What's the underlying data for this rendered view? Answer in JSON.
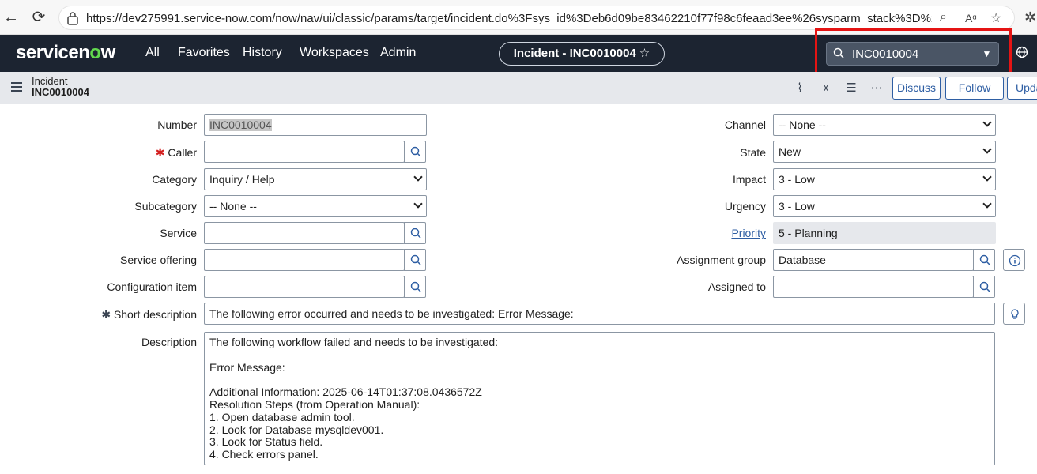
{
  "browser": {
    "url": "https://dev275991.service-now.com/now/nav/ui/classic/params/target/incident.do%3Fsys_id%3Deb6d09be83462210f77f98c6feaad3ee%26sysparm_stack%3D%26sysparm_..."
  },
  "header": {
    "logo_text": "servicen",
    "logo_o": "o",
    "logo_w": "w",
    "nav": [
      "All",
      "Favorites",
      "History",
      "Workspaces",
      "Admin"
    ],
    "record_pill": "Incident - INC0010004",
    "record_star": "☆",
    "search_value": "INC0010004"
  },
  "record_bar": {
    "type": "Incident",
    "number": "INC0010004",
    "discuss": "Discuss",
    "follow": "Follow",
    "update": "Upda"
  },
  "form": {
    "left": {
      "number": {
        "label": "Number",
        "value": "INC0010004"
      },
      "caller": {
        "label": "Caller",
        "value": ""
      },
      "category": {
        "label": "Category",
        "value": "Inquiry / Help"
      },
      "subcategory": {
        "label": "Subcategory",
        "value": "-- None --"
      },
      "service": {
        "label": "Service",
        "value": ""
      },
      "service_offering": {
        "label": "Service offering",
        "value": ""
      },
      "configuration_item": {
        "label": "Configuration item",
        "value": ""
      }
    },
    "right": {
      "channel": {
        "label": "Channel",
        "value": "-- None --"
      },
      "state": {
        "label": "State",
        "value": "New"
      },
      "impact": {
        "label": "Impact",
        "value": "3 - Low"
      },
      "urgency": {
        "label": "Urgency",
        "value": "3 - Low"
      },
      "priority": {
        "label": "Priority",
        "value": "5 - Planning"
      },
      "assignment_group": {
        "label": "Assignment group",
        "value": "Database"
      },
      "assigned_to": {
        "label": "Assigned to",
        "value": ""
      }
    },
    "short_description": {
      "label": "Short description",
      "value": "The following error occurred and needs to be investigated:  Error Message:"
    },
    "description": {
      "label": "Description",
      "value": "The following workflow failed and needs to be investigated:\n\nError Message:\n\nAdditional Information: 2025-06-14T01:37:08.0436572Z\nResolution Steps (from Operation Manual):\n1. Open database admin tool.\n2. Look for Database mysqldev001.\n3. Look for Status field.\n4. Check errors panel."
    },
    "required_marker": "✱"
  }
}
